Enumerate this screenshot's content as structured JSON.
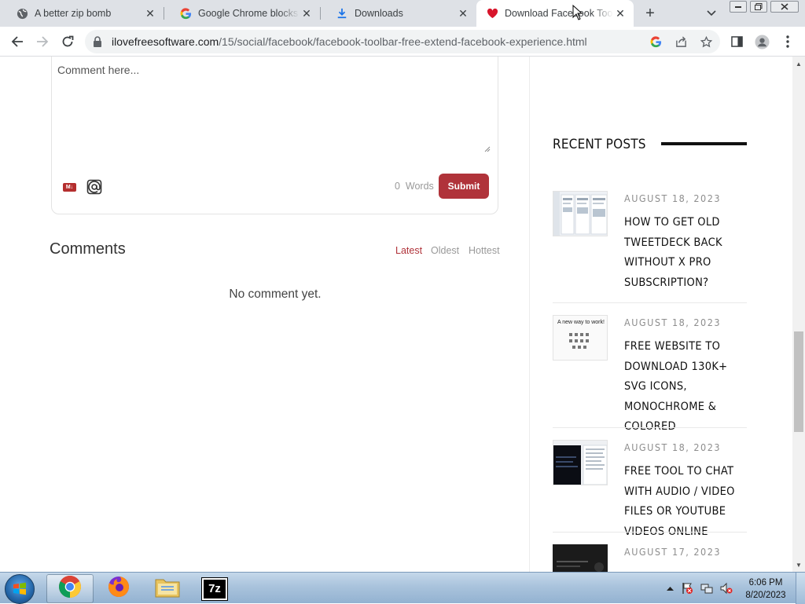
{
  "browser": {
    "tabs": [
      {
        "title": "A better zip bomb",
        "favicon": "globe-icon",
        "active": false
      },
      {
        "title": "Google Chrome blocks some",
        "favicon": "google-g-icon",
        "active": false
      },
      {
        "title": "Downloads",
        "favicon": "download-icon",
        "active": false
      },
      {
        "title": "Download Facebook Toolbar",
        "favicon": "heart-icon",
        "active": true
      }
    ],
    "new_tab_label": "+",
    "close_label": "✕",
    "url_domain": "ilovefreesoftware.com",
    "url_path": "/15/social/facebook/facebook-toolbar-free-extend-facebook-experience.html"
  },
  "comment_form": {
    "placeholder": "Comment here...",
    "markdown_label": "M↓",
    "word_count": "0",
    "word_unit": "Words",
    "submit_label": "Submit"
  },
  "comments": {
    "title": "Comments",
    "sort_options": [
      "Latest",
      "Oldest",
      "Hottest"
    ],
    "active_sort": "Latest",
    "empty_text": "No comment yet."
  },
  "sidebar": {
    "heading": "RECENT POSTS",
    "posts": [
      {
        "date": "AUGUST 18, 2023",
        "title": "How to Get Old TweetDeck Back without X Pro Subscription?",
        "thumb": "tweetdeck-screenshot"
      },
      {
        "date": "AUGUST 18, 2023",
        "title": "Free Website to Download 130K+ SVG Icons, Monochrome & Colored",
        "thumb": "svg-icons-screenshot"
      },
      {
        "date": "AUGUST 18, 2023",
        "title": "Free Tool to Chat with Audio / Video Files or YouTube Videos Online",
        "thumb": "chat-tool-screenshot"
      },
      {
        "date": "AUGUST 17, 2023",
        "title": "",
        "thumb": "dark-screenshot"
      }
    ]
  },
  "taskbar": {
    "apps": [
      {
        "name": "chrome",
        "active": true
      },
      {
        "name": "firefox",
        "active": false
      },
      {
        "name": "file-explorer",
        "active": false
      },
      {
        "name": "7zip",
        "active": false
      }
    ],
    "seven_zip_label": "7z",
    "time": "6:06 PM",
    "date": "8/20/2023"
  },
  "colors": {
    "accent": "#b0333a",
    "chrome_tab_strip": "#dee1e6"
  }
}
